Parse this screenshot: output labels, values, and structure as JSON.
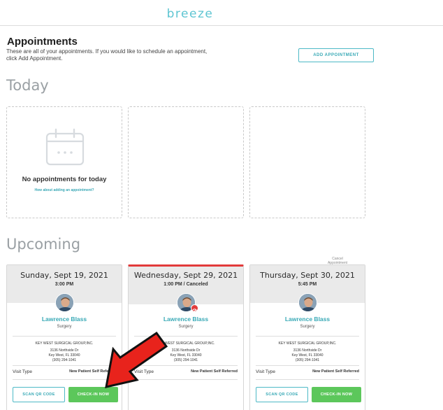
{
  "header": {
    "brand": "breeze"
  },
  "appointments": {
    "title": "Appointments",
    "description": "These are all of your appointments. If you would like to schedule an appointment, click Add Appointment.",
    "add_button": "ADD APPOINTMENT"
  },
  "today": {
    "title": "Today",
    "empty_title": "No appointments for today",
    "empty_link": "How about adding an appointment?"
  },
  "upcoming": {
    "title": "Upcoming",
    "cancel_note": "Cancel Appointment",
    "cards": [
      {
        "date": "Sunday, Sept 19, 2021",
        "time": "3:00 PM",
        "doctor": "Lawrence Blass",
        "specialty": "Surgery",
        "practice": "KEY WEST SURGICAL GROUP,INC.",
        "address1": "3136 Northside Dr",
        "address2": "Key West, FL 33040",
        "phone": "(305) 294-1041",
        "visit_label": "Visit Type",
        "visit_value": "New Patient Self Referred",
        "scan_label": "SCAN QR CODE",
        "checkin_label": "CHECK-IN NOW"
      },
      {
        "date": "Wednesday, Sept 29, 2021",
        "time": "1:00 PM / Canceled",
        "doctor": "Lawrence Blass",
        "specialty": "Surgery",
        "practice": "KEY WEST SURGICAL GROUP,INC.",
        "address1": "3136 Northside Dr",
        "address2": "Key West, FL 33040",
        "phone": "(305) 294-1041",
        "visit_label": "Visit Type",
        "visit_value": "New Patient Self Referred",
        "status_color": "#e23b3b"
      },
      {
        "date": "Thursday, Sept 30, 2021",
        "time": "5:45 PM",
        "doctor": "Lawrence Blass",
        "specialty": "Surgery",
        "practice": "KEY WEST SURGICAL GROUP,INC.",
        "address1": "3136 Northside Dr",
        "address2": "Key West, FL 33040",
        "phone": "(305) 294-1041",
        "visit_label": "Visit Type",
        "visit_value": "New Patient Self Referred",
        "scan_label": "SCAN QR CODE",
        "checkin_label": "CHECK-IN NOW"
      }
    ]
  },
  "colors": {
    "accent": "#4db9c6",
    "success": "#5cc75b",
    "danger": "#e23b3b",
    "annotation_arrow": "#e8231c"
  },
  "icons": {
    "empty_state": "calendar-icon",
    "canceled": "cancel-icon",
    "annotation": "red-arrow-icon"
  }
}
